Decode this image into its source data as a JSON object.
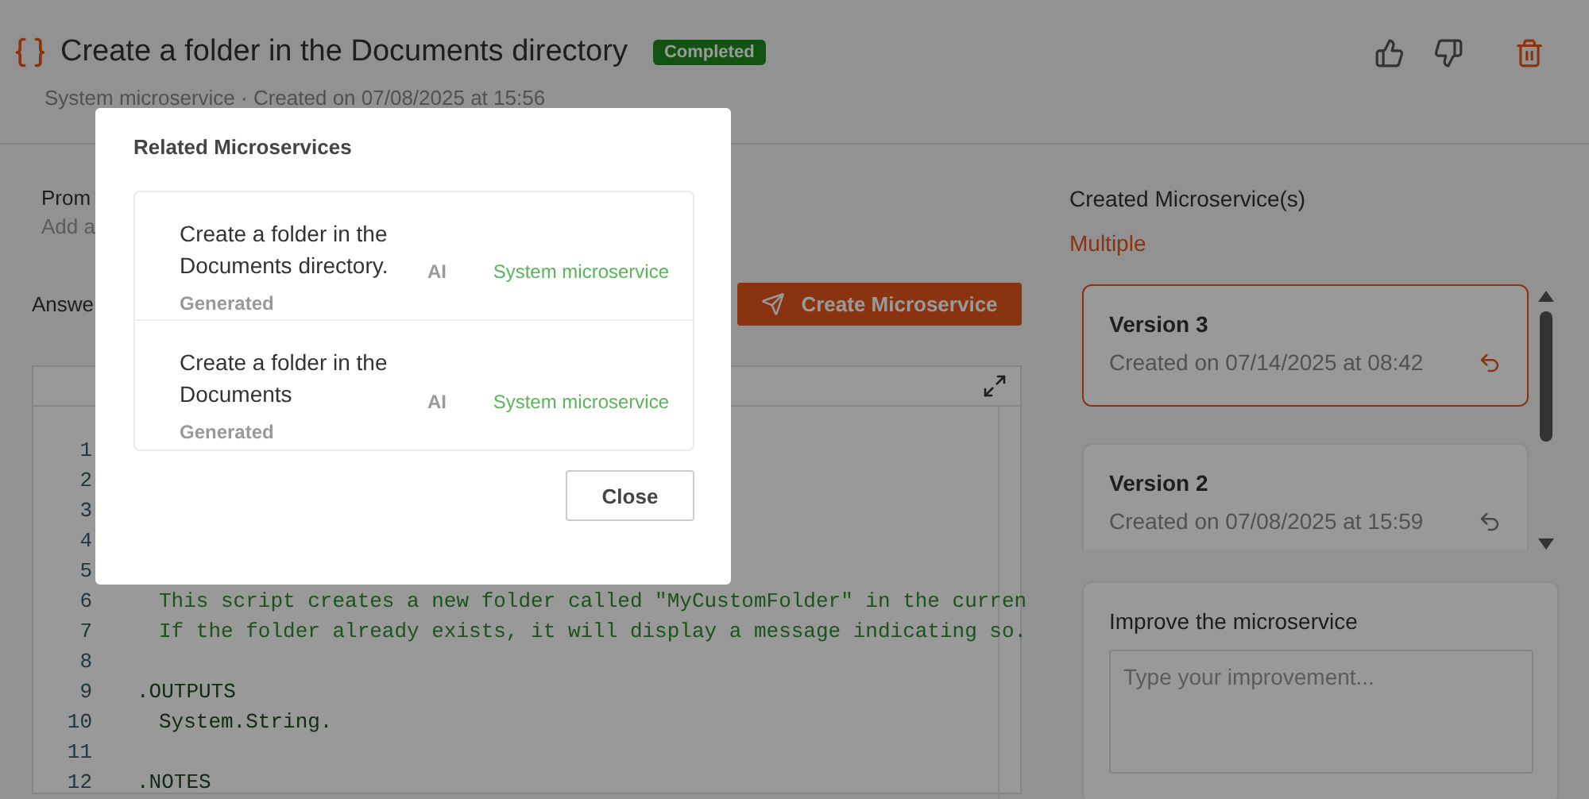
{
  "header": {
    "title": "Create a folder in the Documents directory",
    "status": "Completed",
    "subtitle": "System microservice · Created on 07/08/2025 at 15:56"
  },
  "prompt": {
    "label": "Prom",
    "value": "Add a"
  },
  "answer": {
    "label": "Answe",
    "create_button": "Create Microservice"
  },
  "code_lines": [
    {
      "number": "1"
    },
    {
      "number": "2"
    },
    {
      "number": "3"
    },
    {
      "number": "4"
    },
    {
      "number": "5"
    },
    {
      "number": "6",
      "kind": "comment",
      "text": "This script creates a new folder called \"MyCustomFolder\" in the curren"
    },
    {
      "number": "7",
      "kind": "comment",
      "text": "If the folder already exists, it will display a message indicating so."
    },
    {
      "number": "8"
    },
    {
      "number": "9",
      "kind": "keyword",
      "text": ".OUTPUTS"
    },
    {
      "number": "10",
      "kind": "body",
      "text": "System.String."
    },
    {
      "number": "11"
    },
    {
      "number": "12",
      "kind": "keyword",
      "text": ".NOTES"
    }
  ],
  "created": {
    "label": "Created Microservice(s)",
    "value": "Multiple"
  },
  "versions": [
    {
      "name": "Version 3",
      "date": "Created on 07/14/2025 at 08:42",
      "selected": true
    },
    {
      "name": "Version 2",
      "date": "Created on 07/08/2025 at 15:59",
      "selected": false
    }
  ],
  "improve": {
    "label": "Improve the microservice",
    "placeholder": "Type your improvement..."
  },
  "modal": {
    "title": "Related Microservices",
    "items": [
      {
        "title": "Create a folder in the Documents directory.",
        "ai_label": "AI",
        "generated_label": "Generated",
        "type": "System microservice"
      },
      {
        "title": "Create a folder in the Documents",
        "ai_label": "AI",
        "generated_label": "Generated",
        "type": "System microservice"
      }
    ],
    "close_button": "Close"
  }
}
